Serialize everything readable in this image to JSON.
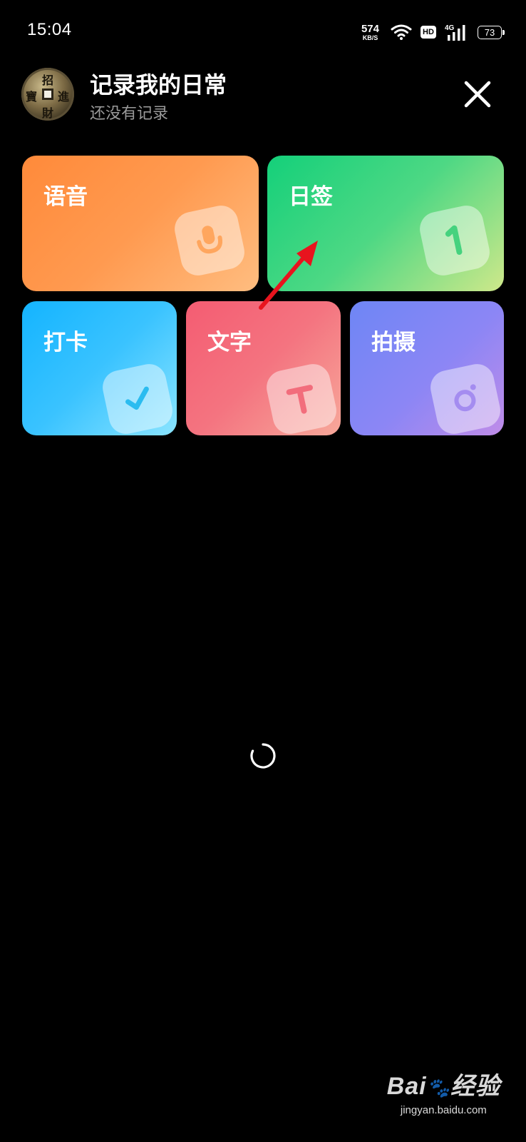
{
  "status_bar": {
    "time": "15:04",
    "net_speed_value": "574",
    "net_speed_unit": "KB/S",
    "hd_label": "HD",
    "network_type": "4G",
    "battery_level": "73"
  },
  "header": {
    "title": "记录我的日常",
    "subtitle": "还没有记录",
    "avatar_glyphs": [
      "招",
      "進",
      "寶",
      "財"
    ]
  },
  "tiles": [
    {
      "label": "语音",
      "icon": "microphone-icon",
      "color": "#ff8a3a"
    },
    {
      "label": "日签",
      "icon": "number-one-icon",
      "color": "#14d07a"
    },
    {
      "label": "打卡",
      "icon": "checkmark-icon",
      "color": "#14b4ff"
    },
    {
      "label": "文字",
      "icon": "letter-t-icon",
      "color": "#f45c72"
    },
    {
      "label": "拍摄",
      "icon": "camera-icon",
      "color": "#7a88f5"
    }
  ],
  "annotation": {
    "arrow_color": "#e8141e"
  },
  "watermark": {
    "logo_text": "Bai",
    "logo_suffix": "经验",
    "site": "jingyan.baidu.com"
  }
}
